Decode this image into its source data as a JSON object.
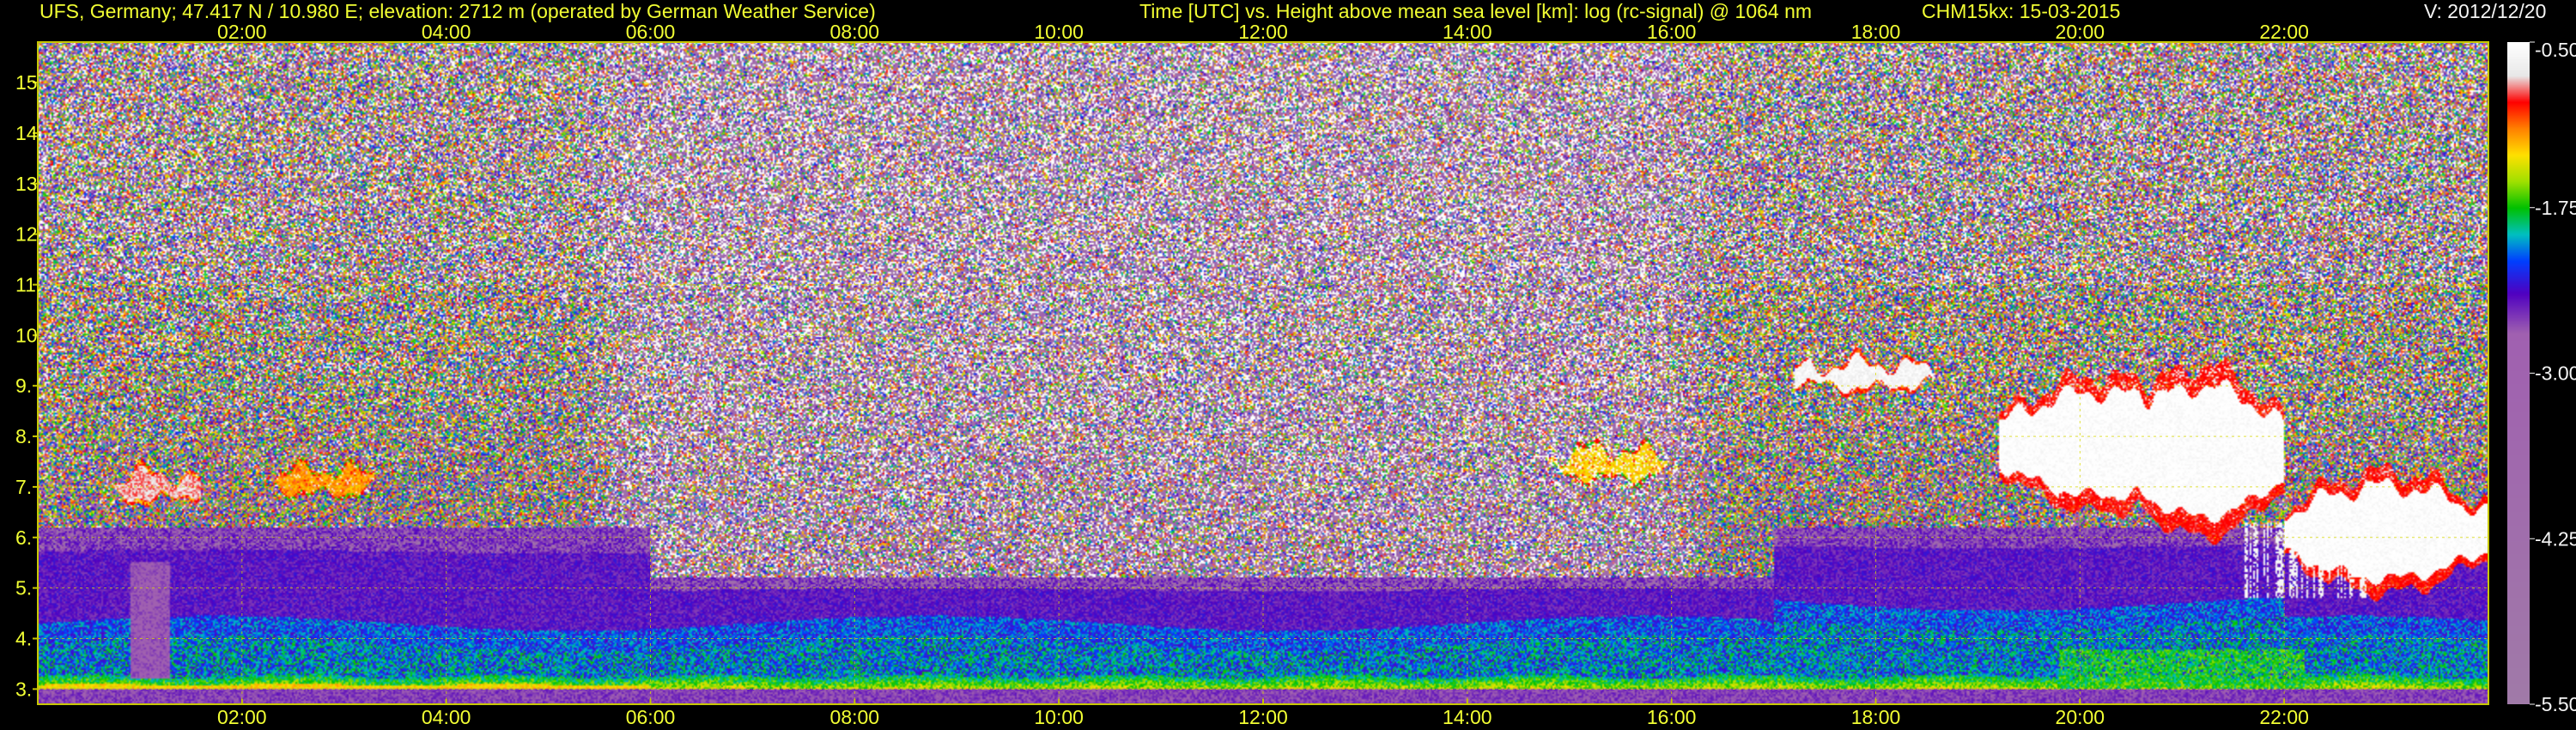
{
  "header": {
    "station": "UFS, Germany; 47.417 N / 10.980 E; elevation: 2712 m  (operated by German Weather Service)",
    "plot_title": "Time [UTC] vs. Height above mean sea level [km]: log (rc-signal) @ 1064 nm",
    "instrument_date": "CHM15kx: 15-03-2015",
    "version": "V: 2012/12/20"
  },
  "colors": {
    "header_text": "#f2ff33",
    "tick_text": "#f2ff33",
    "grid": "#d8d800",
    "frame": "#c8c800",
    "version_text": "#f4f4f4",
    "colorbar_text": "#f4f4f4"
  },
  "chart_data": {
    "type": "heatmap",
    "title": "Time [UTC] vs. Height above mean sea level [km]: log (rc-signal) @ 1064 nm",
    "x_ticks": [
      "02:00",
      "04:00",
      "06:00",
      "08:00",
      "10:00",
      "12:00",
      "14:00",
      "16:00",
      "18:00",
      "20:00",
      "22:00"
    ],
    "x_tick_hours": [
      2,
      4,
      6,
      8,
      10,
      12,
      14,
      16,
      18,
      20,
      22
    ],
    "xlim_hours": [
      0,
      24
    ],
    "y_ticks": [
      "3.",
      "4.",
      "5.",
      "6.",
      "7.",
      "8.",
      "9.",
      "10.",
      "11.",
      "12.",
      "13.",
      "14.",
      "15."
    ],
    "y_tick_values": [
      3,
      4,
      5,
      6,
      7,
      8,
      9,
      10,
      11,
      12,
      13,
      14,
      15
    ],
    "ylim_km": [
      2.7,
      15.8
    ],
    "grid": true,
    "colorbar": {
      "ticks": [
        "-0.50",
        "-1.75",
        "-3.00",
        "-4.25",
        "-5.50"
      ],
      "tick_values": [
        -0.5,
        -1.75,
        -3.0,
        -4.25,
        -5.5
      ],
      "range": [
        -5.5,
        -0.5
      ],
      "stops": [
        {
          "value": -0.5,
          "color": "#ffffff"
        },
        {
          "value": -0.75,
          "color": "#e8e8e8"
        },
        {
          "value": -0.95,
          "color": "#ff0000"
        },
        {
          "value": -1.15,
          "color": "#ff8000"
        },
        {
          "value": -1.35,
          "color": "#ffe000"
        },
        {
          "value": -1.55,
          "color": "#a0e000"
        },
        {
          "value": -1.75,
          "color": "#00c000"
        },
        {
          "value": -1.95,
          "color": "#00c0c0"
        },
        {
          "value": -2.15,
          "color": "#0040ff"
        },
        {
          "value": -2.4,
          "color": "#5000c0"
        },
        {
          "value": -2.7,
          "color": "#a060b0"
        },
        {
          "value": -5.5,
          "color": "#a07aa8"
        }
      ]
    },
    "cloud_layers": [
      {
        "t_start": 0.7,
        "t_end": 1.6,
        "z_base": 6.7,
        "z_top": 7.3,
        "peak": -0.8
      },
      {
        "t_start": 2.3,
        "t_end": 3.3,
        "z_base": 6.8,
        "z_top": 7.4,
        "peak": -1.2
      },
      {
        "t_start": 14.8,
        "t_end": 16.0,
        "z_base": 7.1,
        "z_top": 7.8,
        "peak": -1.3
      },
      {
        "t_start": 17.2,
        "t_end": 18.6,
        "z_base": 8.9,
        "z_top": 9.5,
        "peak": -0.6
      },
      {
        "t_start": 19.2,
        "t_end": 21.2,
        "z_base": 6.5,
        "z_top": 9.2,
        "peak": -0.5
      },
      {
        "t_start": 20.4,
        "t_end": 22.0,
        "z_base": 6.0,
        "z_top": 9.4,
        "peak": -0.5
      },
      {
        "t_start": 22.0,
        "t_end": 24.0,
        "z_base": 4.9,
        "z_top": 7.3,
        "peak": -0.5
      }
    ],
    "boundary_layer": {
      "surface_band_top_km": 3.25,
      "blue_layer_top_km": 4.3,
      "purple_layer_top_km": 6.2
    }
  }
}
